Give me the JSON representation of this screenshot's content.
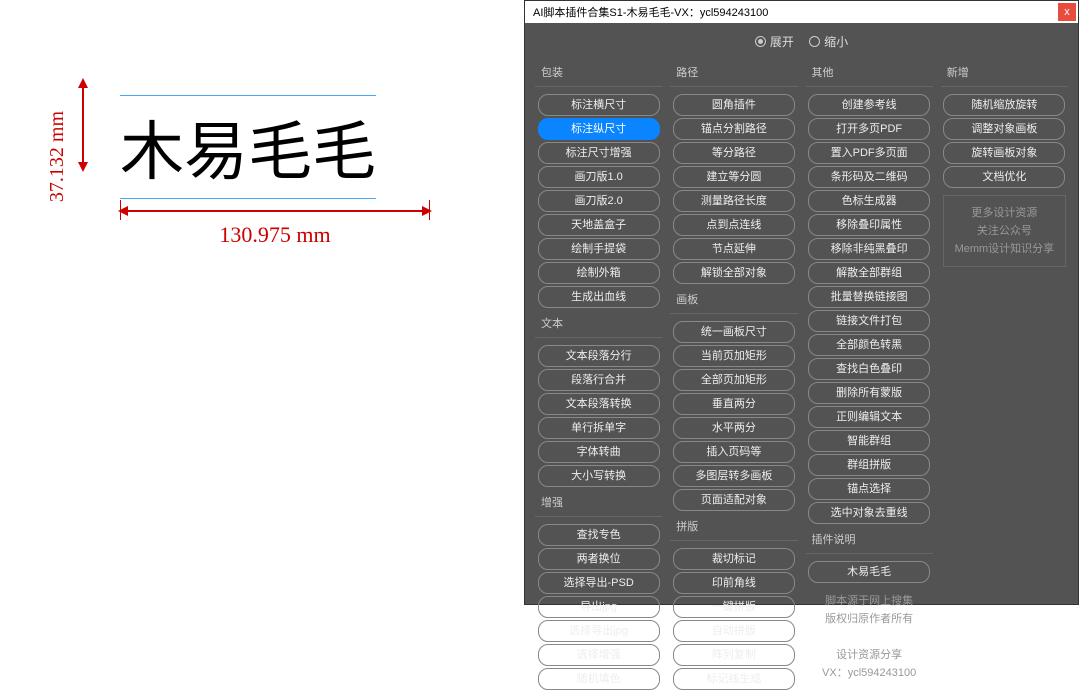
{
  "canvas": {
    "mainText": "木易毛毛",
    "vDim": "37.132 mm",
    "hDim": "130.975 mm"
  },
  "panel": {
    "title": "AI脚本插件合集S1-木易毛毛-VX：ycl594243100",
    "closeLabel": "x",
    "toggle": {
      "expand": "展开",
      "collapse": "缩小"
    }
  },
  "sections": {
    "col1": [
      {
        "title": "包装",
        "items": [
          "标注横尺寸",
          "标注纵尺寸",
          "标注尺寸增强",
          "画刀版1.0",
          "画刀版2.0",
          "天地盖盒子",
          "绘制手提袋",
          "绘制外箱",
          "生成出血线"
        ]
      },
      {
        "title": "文本",
        "items": [
          "文本段落分行",
          "段落行合并",
          "文本段落转换",
          "单行拆单字",
          "字体转曲",
          "大小写转换"
        ]
      },
      {
        "title": "增强",
        "items": [
          "查找专色",
          "两者换位",
          "选择导出-PSD",
          "导出jpg",
          "选择导出jpg",
          "选择增强",
          "随机填色"
        ]
      }
    ],
    "col2": [
      {
        "title": "路径",
        "items": [
          "圆角插件",
          "锚点分割路径",
          "等分路径",
          "建立等分圆",
          "测量路径长度",
          "点到点连线",
          "节点延伸",
          "解锁全部对象"
        ]
      },
      {
        "title": "画板",
        "items": [
          "统一画板尺寸",
          "当前页加矩形",
          "全部页加矩形",
          "垂直两分",
          "水平两分",
          "插入页码等",
          "多图层转多画板",
          "页面适配对象"
        ]
      },
      {
        "title": "拼版",
        "items": [
          "裁切标记",
          "印前角线",
          "一键拼版",
          "自动拼版",
          "阵列复制",
          "标记线生成"
        ]
      }
    ],
    "col3": [
      {
        "title": "其他",
        "items": [
          "创建参考线",
          "打开多页PDF",
          "置入PDF多页面",
          "条形码及二维码",
          "色标生成器",
          "移除叠印属性",
          "移除非纯黑叠印",
          "解散全部群组",
          "批量替换链接图",
          "链接文件打包",
          "全部颜色转黑",
          "查找白色叠印",
          "删除所有蒙版",
          "正则编辑文本",
          "智能群组",
          "群组拼版",
          "锚点选择",
          "选中对象去重线"
        ]
      }
    ],
    "col4": [
      {
        "title": "新增",
        "items": [
          "随机缩放旋转",
          "调整对象画板",
          "旋转画板对象",
          "文档优化"
        ]
      }
    ]
  },
  "infoBox": {
    "line1": "更多设计资源",
    "line2": "关注公众号",
    "line3": "Memm设计知识分享"
  },
  "pluginInfo": {
    "title": "插件说明",
    "author": "木易毛毛",
    "line1": "脚本源于网上搜集",
    "line2": "版权归原作者所有",
    "line3": "设计资源分享",
    "line4": "VX：ycl594243100"
  }
}
